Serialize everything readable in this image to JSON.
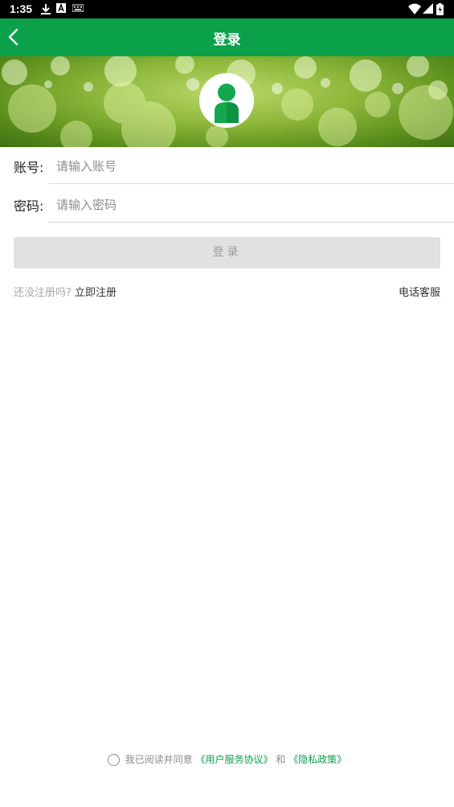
{
  "status_bar": {
    "time": "1:35",
    "icons": [
      "download-icon",
      "a-icon",
      "keyboard-icon",
      "wifi-icon",
      "signal-icon",
      "battery-icon"
    ]
  },
  "app_bar": {
    "title": "登录",
    "back_icon": "chevron-left-icon"
  },
  "colors": {
    "primary": "#0aa14a",
    "button_disabled": "#e1e1e3",
    "link": "#0aa14a"
  },
  "form": {
    "account": {
      "label": "账号:",
      "placeholder": "请输入账号",
      "value": ""
    },
    "password": {
      "label": "密码:",
      "placeholder": "请输入密码",
      "value": ""
    },
    "submit_label": "登录"
  },
  "links": {
    "question": "还没注册吗?",
    "register": "立即注册",
    "phone_service": "电话客服"
  },
  "agreement": {
    "prefix": "我已阅读并同意",
    "user_agreement": "《用户服务协议》",
    "and": "和",
    "privacy": "《隐私政策》"
  }
}
